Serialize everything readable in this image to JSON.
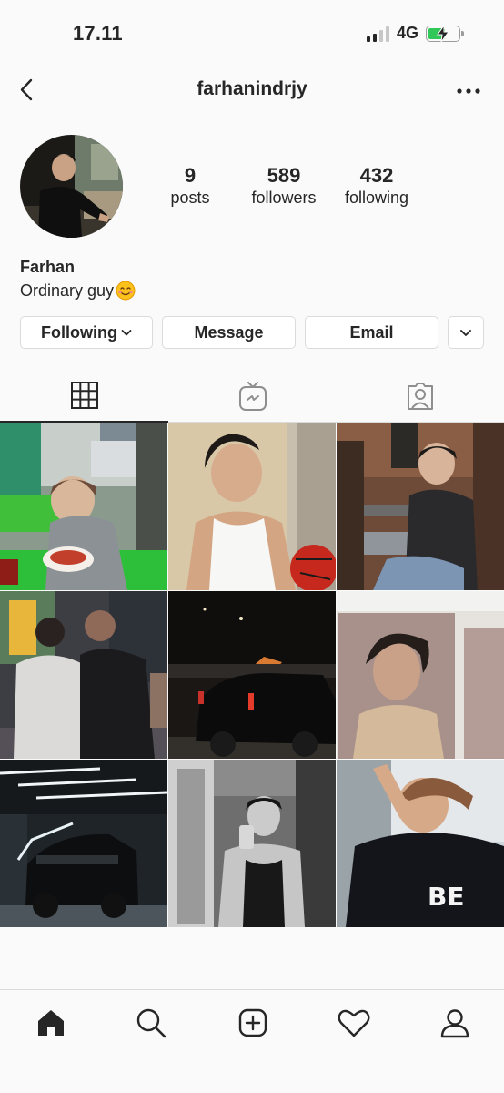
{
  "status_bar": {
    "time": "17.11",
    "network": "4G"
  },
  "header": {
    "username": "farhanindrjy",
    "back_icon": "chevron-left-icon",
    "more_icon": "ellipsis-icon"
  },
  "profile": {
    "display_name": "Farhan",
    "bio": "Ordinary guy",
    "bio_emoji": "smiling-face-emoji",
    "stats": {
      "posts_count": "9",
      "posts_label": "posts",
      "followers_count": "589",
      "followers_label": "followers",
      "following_count": "432",
      "following_label": "following"
    }
  },
  "actions": {
    "following_label": "Following",
    "message_label": "Message",
    "email_label": "Email"
  },
  "tabs": [
    {
      "name": "grid",
      "icon": "grid-icon",
      "active": true
    },
    {
      "name": "igtv",
      "icon": "igtv-icon",
      "active": false
    },
    {
      "name": "tagged",
      "icon": "tagged-person-icon",
      "active": false
    }
  ],
  "posts_count_visible": 9,
  "bottom_nav": [
    {
      "name": "home",
      "icon": "home-icon"
    },
    {
      "name": "search",
      "icon": "search-icon"
    },
    {
      "name": "new-post",
      "icon": "add-post-icon"
    },
    {
      "name": "activity",
      "icon": "heart-icon"
    },
    {
      "name": "profile",
      "icon": "profile-icon"
    }
  ],
  "colors": {
    "text": "#262626",
    "border": "#dbdbdb",
    "background": "#fafafa",
    "battery": "#32c759"
  }
}
